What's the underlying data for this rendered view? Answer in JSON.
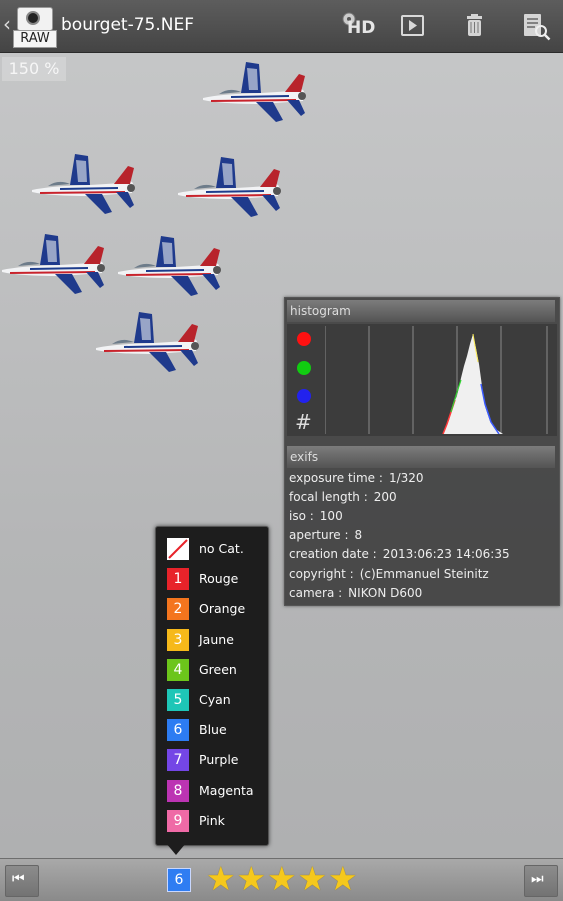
{
  "header": {
    "back_glyph": "‹",
    "raw_badge": "RAW",
    "filename": "bourget-75.NEF",
    "hd_label": "HD",
    "icons": [
      "back-icon",
      "camera-raw-icon",
      "hd-icon",
      "play-icon",
      "trash-icon",
      "exif-search-icon"
    ]
  },
  "zoom": "150 %",
  "info_panel": {
    "histogram_title": "histogram",
    "exifs_title": "exifs",
    "grid_glyph": "#",
    "exifs": [
      {
        "label": "exposure time :",
        "value": "1/320"
      },
      {
        "label": "focal length :",
        "value": "200"
      },
      {
        "label": "iso :",
        "value": "100"
      },
      {
        "label": "aperture :",
        "value": "8"
      },
      {
        "label": "creation date :",
        "value": "2013:06:23 14:06:35"
      },
      {
        "label": "copyright :",
        "value": "(c)Emmanuel Steinitz"
      },
      {
        "label": "camera :",
        "value": "NIKON D600"
      }
    ]
  },
  "category_menu": {
    "items": [
      {
        "num": "",
        "label": "no Cat.",
        "color": "#ffffff"
      },
      {
        "num": "1",
        "label": "Rouge",
        "color": "#e8232a"
      },
      {
        "num": "2",
        "label": "Orange",
        "color": "#f4751e"
      },
      {
        "num": "3",
        "label": "Jaune",
        "color": "#f6b91a"
      },
      {
        "num": "4",
        "label": "Green",
        "color": "#6cc51b"
      },
      {
        "num": "5",
        "label": "Cyan",
        "color": "#1ec6b7"
      },
      {
        "num": "6",
        "label": "Blue",
        "color": "#2d7cf2"
      },
      {
        "num": "7",
        "label": "Purple",
        "color": "#7446e6"
      },
      {
        "num": "8",
        "label": "Magenta",
        "color": "#bc34b3"
      },
      {
        "num": "9",
        "label": "Pink",
        "color": "#ef6aa6"
      }
    ]
  },
  "bottom_bar": {
    "category_badge": "6",
    "rating": 5,
    "star_glyph": "★",
    "prev_glyph": "⏮",
    "next_glyph": "⏭"
  }
}
